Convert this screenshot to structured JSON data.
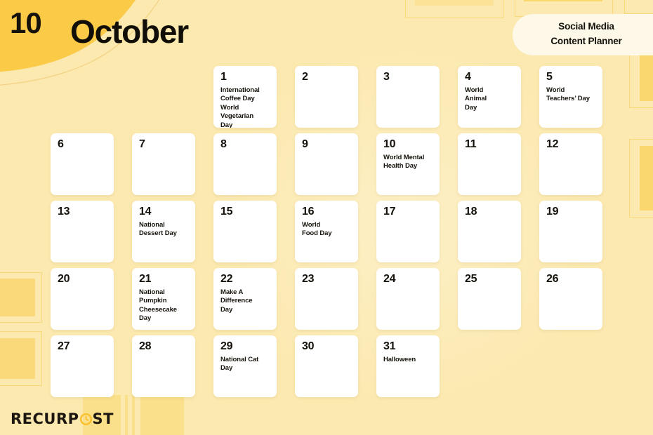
{
  "header": {
    "month_number": "10",
    "month_name": "October",
    "badge_line1": "Social Media",
    "badge_line2": "Content Planner"
  },
  "calendar": {
    "leading_blanks": 2,
    "days": [
      {
        "num": "1",
        "event": "International\nCoffee Day\nWorld\nVegetarian\nDay"
      },
      {
        "num": "2",
        "event": ""
      },
      {
        "num": "3",
        "event": ""
      },
      {
        "num": "4",
        "event": "World\nAnimal\nDay"
      },
      {
        "num": "5",
        "event": "World\nTeachers’ Day"
      },
      {
        "num": "6",
        "event": ""
      },
      {
        "num": "7",
        "event": ""
      },
      {
        "num": "8",
        "event": ""
      },
      {
        "num": "9",
        "event": ""
      },
      {
        "num": "10",
        "event": "World Mental\nHealth Day"
      },
      {
        "num": "11",
        "event": ""
      },
      {
        "num": "12",
        "event": ""
      },
      {
        "num": "13",
        "event": ""
      },
      {
        "num": "14",
        "event": "National\nDessert Day"
      },
      {
        "num": "15",
        "event": ""
      },
      {
        "num": "16",
        "event": "World\nFood Day"
      },
      {
        "num": "17",
        "event": ""
      },
      {
        "num": "18",
        "event": ""
      },
      {
        "num": "19",
        "event": ""
      },
      {
        "num": "20",
        "event": ""
      },
      {
        "num": "21",
        "event": "National\nPumpkin\nCheesecake\nDay"
      },
      {
        "num": "22",
        "event": "Make A\nDifference\nDay"
      },
      {
        "num": "23",
        "event": ""
      },
      {
        "num": "24",
        "event": ""
      },
      {
        "num": "25",
        "event": ""
      },
      {
        "num": "26",
        "event": ""
      },
      {
        "num": "27",
        "event": ""
      },
      {
        "num": "28",
        "event": ""
      },
      {
        "num": "29",
        "event": "National Cat\nDay"
      },
      {
        "num": "30",
        "event": ""
      },
      {
        "num": "31",
        "event": "Halloween"
      }
    ]
  },
  "logo": {
    "text_before": "RECURP",
    "text_after": "ST",
    "icon": "clock-icon"
  },
  "colors": {
    "background": "#fbe9b0",
    "accent_yellow": "#fbcb48",
    "deco_yellow": "#fbd86e",
    "card_white": "#ffffff",
    "badge_cream": "#fdf8e8",
    "text_dark": "#14100a"
  }
}
